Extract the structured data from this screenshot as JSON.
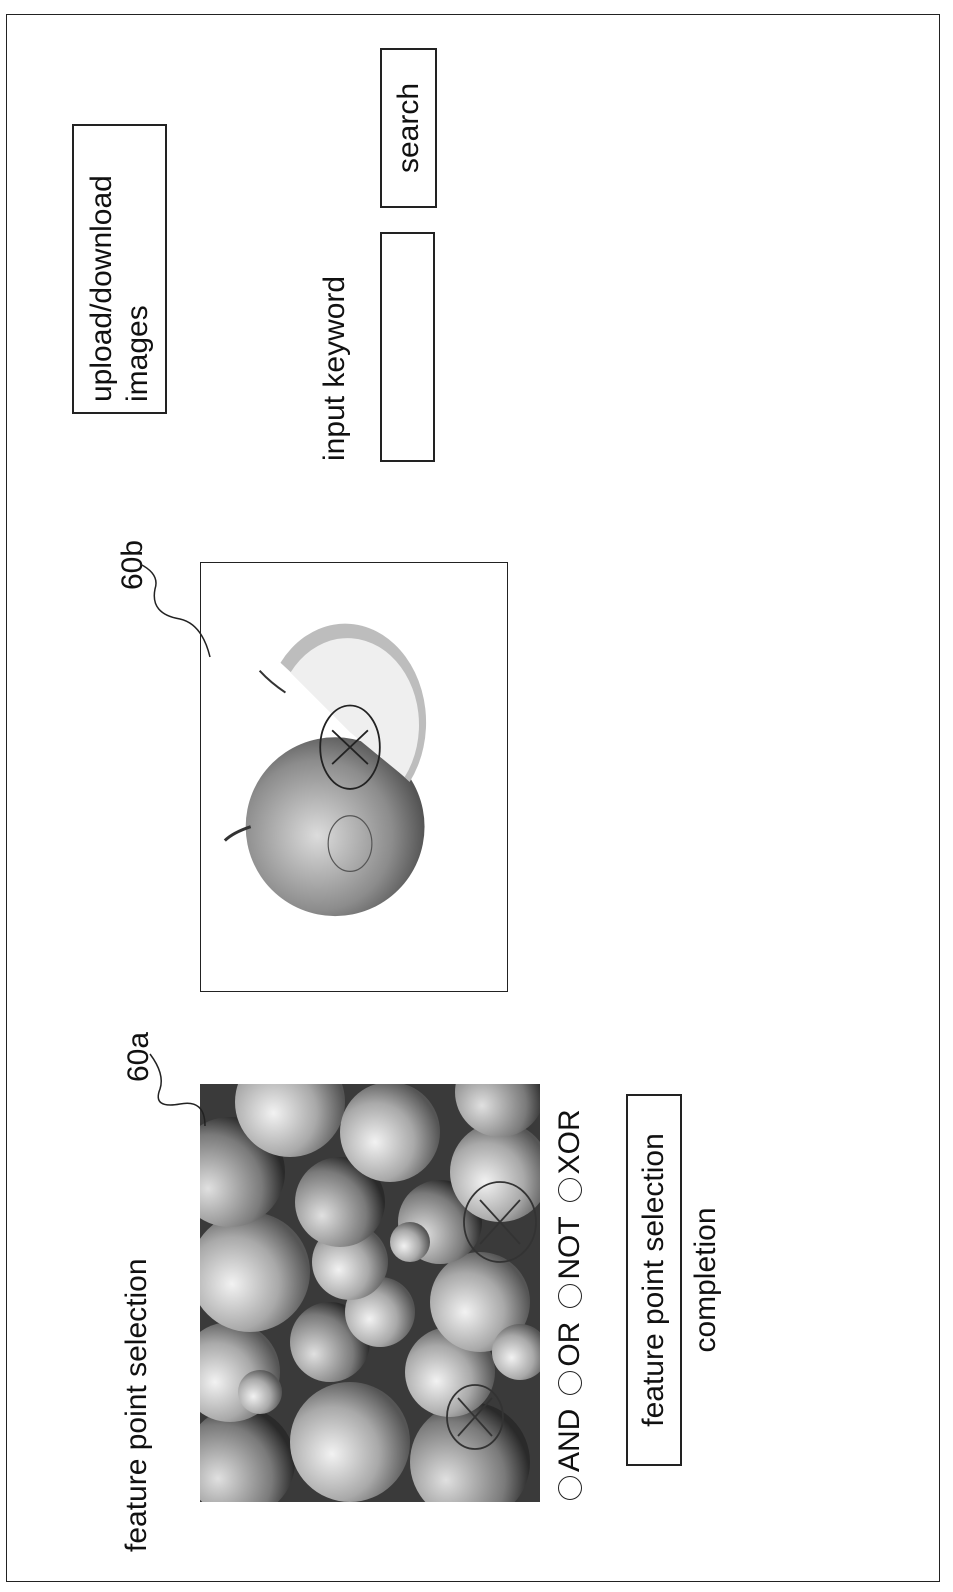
{
  "toolbar": {
    "upload_label": "upload/download\nimages",
    "keyword_label": "input keyword",
    "keyword_value": "",
    "search_label": "search"
  },
  "feature_selection": {
    "title": "feature point selection",
    "image_a_ref": "60a",
    "image_b_ref": "60b",
    "operators": [
      "AND",
      "OR",
      "NOT",
      "XOR"
    ],
    "complete_label": "feature point selection completion"
  },
  "icons": {
    "marker": "x-in-circle-icon",
    "radio": "radio-button-icon"
  },
  "colors": {
    "line": "#222222",
    "background": "#ffffff"
  }
}
